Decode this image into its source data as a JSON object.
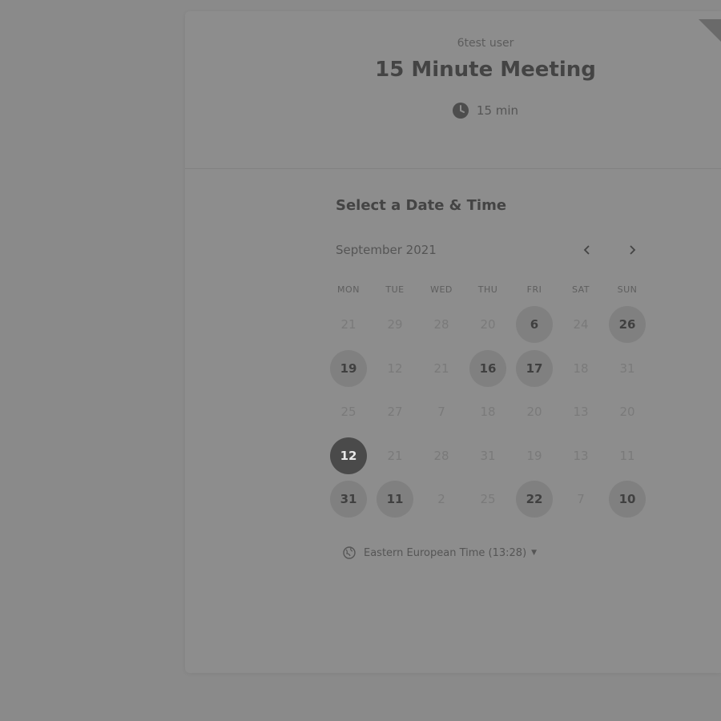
{
  "header": {
    "host_name": "6test user",
    "event_title": "15 Minute Meeting",
    "duration": "15 min"
  },
  "calendar": {
    "section_title": "Select a Date & Time",
    "month_label": "September 2021",
    "prev_icon": "chevron-left-icon",
    "next_icon": "chevron-right-icon",
    "weekdays": [
      "MON",
      "TUE",
      "WED",
      "THU",
      "FRI",
      "SAT",
      "SUN"
    ],
    "weeks": [
      [
        "21",
        "29",
        "28",
        "20",
        "6",
        "24",
        "26"
      ],
      [
        "19",
        "12",
        "21",
        "16",
        "17",
        "18",
        "31"
      ],
      [
        "25",
        "27",
        "7",
        "18",
        "20",
        "13",
        "20"
      ],
      [
        "12",
        "21",
        "28",
        "31",
        "19",
        "13",
        "11"
      ],
      [
        "31",
        "11",
        "2",
        "25",
        "22",
        "7",
        "10"
      ]
    ],
    "available": [
      [
        0,
        4
      ],
      [
        0,
        6
      ],
      [
        1,
        0
      ],
      [
        1,
        3
      ],
      [
        1,
        4
      ],
      [
        4,
        0
      ],
      [
        4,
        1
      ],
      [
        4,
        4
      ],
      [
        4,
        6
      ]
    ],
    "selected": [
      3,
      0
    ]
  },
  "timezone": {
    "label": "Eastern European Time (13:28)",
    "icon": "globe-icon"
  },
  "colors": {
    "overlay_background": "#8a8a8a",
    "selected_day": "#4a4a4a",
    "available_day": "#808080"
  }
}
